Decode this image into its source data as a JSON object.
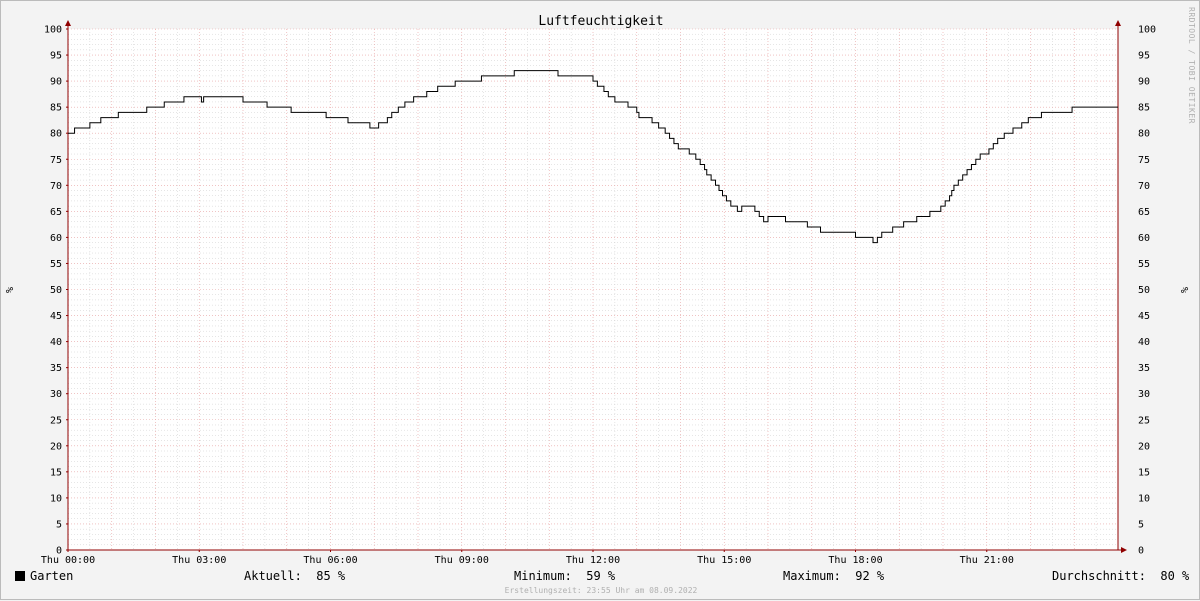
{
  "chart_data": {
    "type": "line",
    "title": "Luftfeuchtigkeit",
    "ylabel": "%",
    "ylim": [
      0,
      100
    ],
    "y_ticks": [
      0,
      5,
      10,
      15,
      20,
      25,
      30,
      35,
      40,
      45,
      50,
      55,
      60,
      65,
      70,
      75,
      80,
      85,
      90,
      95,
      100
    ],
    "x_range_hours": [
      0,
      24
    ],
    "x_ticks": [
      {
        "hour": 0,
        "label": "Thu 00:00"
      },
      {
        "hour": 3,
        "label": "Thu 03:00"
      },
      {
        "hour": 6,
        "label": "Thu 06:00"
      },
      {
        "hour": 9,
        "label": "Thu 09:00"
      },
      {
        "hour": 12,
        "label": "Thu 12:00"
      },
      {
        "hour": 15,
        "label": "Thu 15:00"
      },
      {
        "hour": 18,
        "label": "Thu 18:00"
      },
      {
        "hour": 21,
        "label": "Thu 21:00"
      }
    ],
    "grid": true,
    "step": true,
    "series": [
      {
        "name": "Garten",
        "color": "#000000",
        "points": [
          [
            0.0,
            80
          ],
          [
            0.15,
            81
          ],
          [
            0.5,
            82
          ],
          [
            0.75,
            83
          ],
          [
            1.15,
            84
          ],
          [
            1.8,
            85
          ],
          [
            2.2,
            86
          ],
          [
            2.65,
            87
          ],
          [
            3.05,
            86
          ],
          [
            3.1,
            87
          ],
          [
            4.0,
            86
          ],
          [
            4.55,
            85
          ],
          [
            5.1,
            84
          ],
          [
            5.9,
            83
          ],
          [
            6.4,
            82
          ],
          [
            6.9,
            81
          ],
          [
            7.1,
            82
          ],
          [
            7.3,
            83
          ],
          [
            7.4,
            84
          ],
          [
            7.55,
            85
          ],
          [
            7.7,
            86
          ],
          [
            7.9,
            87
          ],
          [
            8.2,
            88
          ],
          [
            8.45,
            89
          ],
          [
            8.85,
            90
          ],
          [
            9.45,
            91
          ],
          [
            10.2,
            92
          ],
          [
            11.2,
            91
          ],
          [
            12.0,
            90
          ],
          [
            12.1,
            89
          ],
          [
            12.25,
            88
          ],
          [
            12.35,
            87
          ],
          [
            12.5,
            86
          ],
          [
            12.8,
            85
          ],
          [
            13.0,
            84
          ],
          [
            13.05,
            83
          ],
          [
            13.35,
            82
          ],
          [
            13.5,
            81
          ],
          [
            13.65,
            80
          ],
          [
            13.75,
            79
          ],
          [
            13.85,
            78
          ],
          [
            13.95,
            77
          ],
          [
            14.2,
            76
          ],
          [
            14.35,
            75
          ],
          [
            14.45,
            74
          ],
          [
            14.55,
            73
          ],
          [
            14.6,
            72
          ],
          [
            14.7,
            71
          ],
          [
            14.8,
            70
          ],
          [
            14.88,
            69
          ],
          [
            14.96,
            68
          ],
          [
            15.05,
            67
          ],
          [
            15.15,
            66
          ],
          [
            15.3,
            65
          ],
          [
            15.4,
            66
          ],
          [
            15.7,
            65
          ],
          [
            15.8,
            64
          ],
          [
            15.9,
            63
          ],
          [
            16.0,
            64
          ],
          [
            16.4,
            63
          ],
          [
            16.9,
            62
          ],
          [
            17.2,
            61
          ],
          [
            18.0,
            60
          ],
          [
            18.4,
            59
          ],
          [
            18.5,
            60
          ],
          [
            18.6,
            61
          ],
          [
            18.85,
            62
          ],
          [
            19.1,
            63
          ],
          [
            19.4,
            64
          ],
          [
            19.7,
            65
          ],
          [
            19.95,
            66
          ],
          [
            20.05,
            67
          ],
          [
            20.15,
            68
          ],
          [
            20.2,
            69
          ],
          [
            20.25,
            70
          ],
          [
            20.35,
            71
          ],
          [
            20.45,
            72
          ],
          [
            20.55,
            73
          ],
          [
            20.65,
            74
          ],
          [
            20.75,
            75
          ],
          [
            20.85,
            76
          ],
          [
            21.05,
            77
          ],
          [
            21.15,
            78
          ],
          [
            21.25,
            79
          ],
          [
            21.4,
            80
          ],
          [
            21.6,
            81
          ],
          [
            21.8,
            82
          ],
          [
            21.95,
            83
          ],
          [
            22.25,
            84
          ],
          [
            22.95,
            85
          ],
          [
            24.0,
            85
          ]
        ]
      }
    ],
    "legend": {
      "series_label": "Garten",
      "current_label": "Aktuell:",
      "current_value": "85 %",
      "min_label": "Minimum:",
      "min_value": "59 %",
      "max_label": "Maximum:",
      "max_value": "92 %",
      "avg_label": "Durchschnitt:",
      "avg_value": "80 %"
    },
    "footer": "Erstellungszeit: 23:55 Uhr am 08.09.2022",
    "watermark": "RRDTOOL / TOBI OETIKER",
    "colors": {
      "background": "#f3f3f3",
      "canvas": "#ffffff",
      "major_grid": "#e6a0a0",
      "minor_grid": "#cccccc",
      "axis": "#900000",
      "line": "#000000"
    }
  }
}
